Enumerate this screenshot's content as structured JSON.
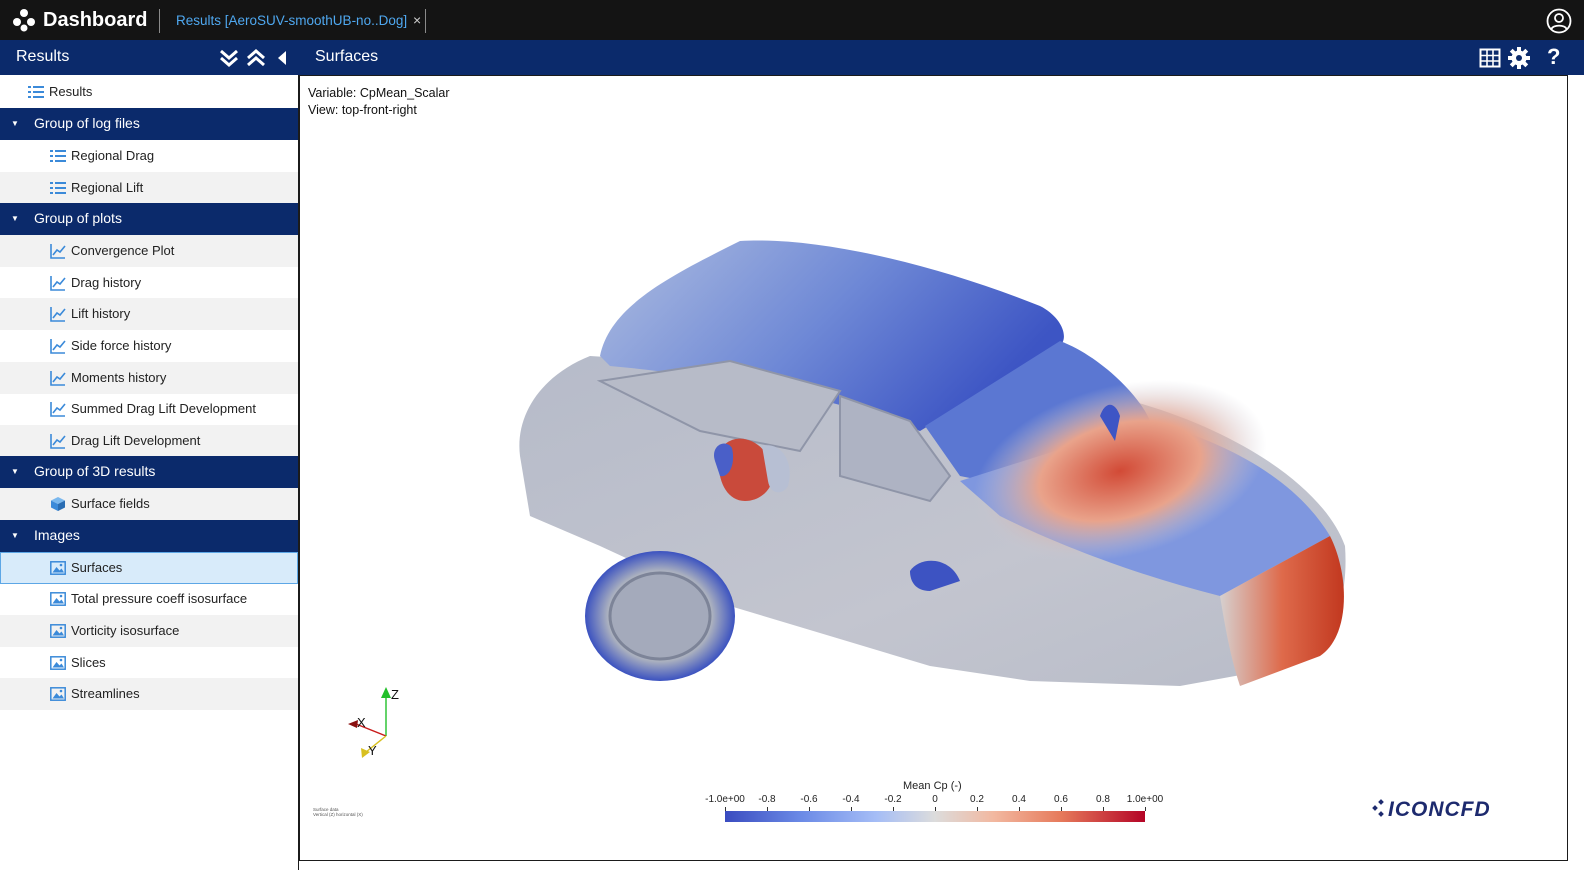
{
  "app": {
    "title": "Dashboard"
  },
  "tab": {
    "label": "Results [AeroSUV-smoothUB-no..Dog]",
    "close": "×"
  },
  "sidebar": {
    "title": "Results",
    "root_label": "Results",
    "groups": [
      {
        "label": "Group of log files",
        "items": [
          {
            "label": "Regional Drag",
            "icon": "list-icon"
          },
          {
            "label": "Regional Lift",
            "icon": "list-icon"
          }
        ]
      },
      {
        "label": "Group of plots",
        "items": [
          {
            "label": "Convergence Plot",
            "icon": "line-chart-icon"
          },
          {
            "label": "Drag history",
            "icon": "line-chart-icon"
          },
          {
            "label": "Lift history",
            "icon": "line-chart-icon"
          },
          {
            "label": "Side force history",
            "icon": "line-chart-icon"
          },
          {
            "label": "Moments history",
            "icon": "line-chart-icon"
          },
          {
            "label": "Summed Drag Lift Development",
            "icon": "line-chart-icon"
          },
          {
            "label": "Drag Lift Development",
            "icon": "line-chart-icon"
          }
        ]
      },
      {
        "label": "Group of 3D results",
        "items": [
          {
            "label": "Surface fields",
            "icon": "cube-icon"
          }
        ]
      },
      {
        "label": "Images",
        "items": [
          {
            "label": "Surfaces",
            "icon": "image-icon",
            "selected": true
          },
          {
            "label": "Total pressure coeff isosurface",
            "icon": "image-icon"
          },
          {
            "label": "Vorticity isosurface",
            "icon": "image-icon"
          },
          {
            "label": "Slices",
            "icon": "image-icon"
          },
          {
            "label": "Streamlines",
            "icon": "image-icon"
          }
        ]
      }
    ]
  },
  "main": {
    "title": "Surfaces"
  },
  "viewer": {
    "variable_line": "Variable: CpMean_Scalar",
    "view_line": "View: top-front-right",
    "tiny_note_1": "Surface data",
    "tiny_note_2": "Vertical (Z) horizontal (X)",
    "axes": {
      "z": "Z",
      "x": "X",
      "y": "Y"
    },
    "colorbar": {
      "title": "Mean Cp (-)",
      "labels": [
        "-1.0e+00",
        "-0.8",
        "-0.6",
        "-0.4",
        "-0.2",
        "0",
        "0.2",
        "0.4",
        "0.6",
        "0.8",
        "1.0e+00"
      ],
      "range": [
        -1.0,
        1.0
      ]
    },
    "brand": "ICONCFD"
  },
  "colors": {
    "header_blue": "#0b2a6b",
    "topbar": "#141414",
    "tab_link": "#4fa8f0",
    "selected_bg": "#d8ebfa",
    "cmap_low": "#3a4cc0",
    "cmap_mid": "#dcdcdc",
    "cmap_high": "#b40426"
  }
}
